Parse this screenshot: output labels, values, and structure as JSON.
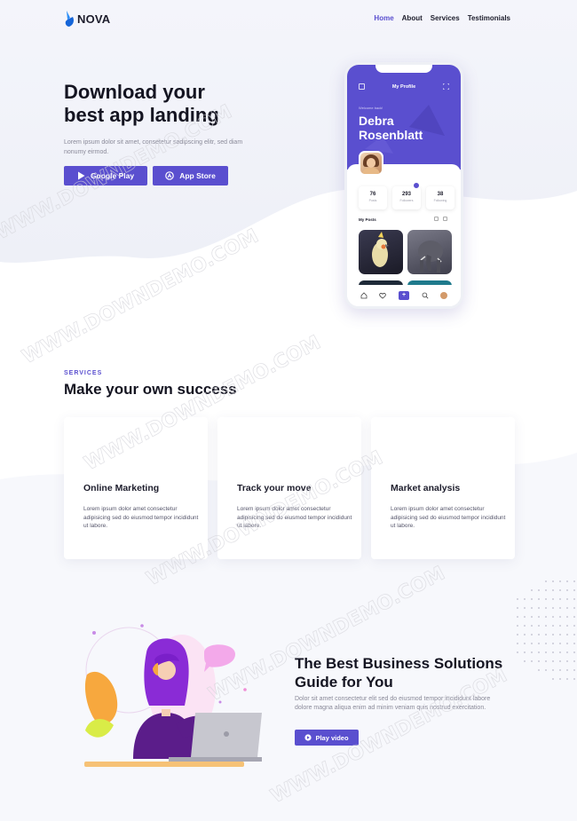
{
  "brand": {
    "name": "NOVA",
    "accent": "#5a4fcf",
    "logo_color": "#2b8ef7"
  },
  "nav": {
    "items": [
      {
        "label": "Home",
        "active": true
      },
      {
        "label": "About",
        "active": false
      },
      {
        "label": "Services",
        "active": false
      },
      {
        "label": "Testimonials",
        "active": false
      }
    ]
  },
  "hero": {
    "title_line1": "Download your",
    "title_line2": "best app landing",
    "text": "Lorem ipsum dolor sit amet, consetetur sadipscing elitr, sed diam nonumy eirmod.",
    "google_play_label": "Google Play",
    "app_store_label": "App Store"
  },
  "phone": {
    "header_title": "My Profile",
    "welcome": "Welcome back!",
    "name": "Debra Rosenblatt",
    "stats": [
      {
        "num": "76",
        "label": "Posts"
      },
      {
        "num": "293",
        "label": "Followers"
      },
      {
        "num": "38",
        "label": "Following"
      }
    ],
    "posts_title": "My Posts"
  },
  "services": {
    "eyebrow": "SERVICES",
    "title": "Make your own success",
    "cards": [
      {
        "title": "Online Marketing",
        "text": "Lorem ipsum dolor amet consectetur adipisicing sed do eiusmod tempor incididunt ut labore."
      },
      {
        "title": "Track your move",
        "text": "Lorem ipsum dolor amet consectetur adipisicing sed do eiusmod tempor incididunt ut labore."
      },
      {
        "title": "Market analysis",
        "text": "Lorem ipsum dolor amet consectetur adipisicing sed do eiusmod tempor incididunt ut labore."
      }
    ]
  },
  "solutions": {
    "title_line1": "The Best Business Solutions",
    "title_line2": "Guide for You",
    "text": "Dolor sit amet consectetur elit sed do eiusmod tempor incididunt labore dolore magna aliqua enim ad minim veniam quis nostrud exercitation.",
    "play_label": "Play video"
  },
  "watermark": "WWW.DOWNDEMO.COM"
}
